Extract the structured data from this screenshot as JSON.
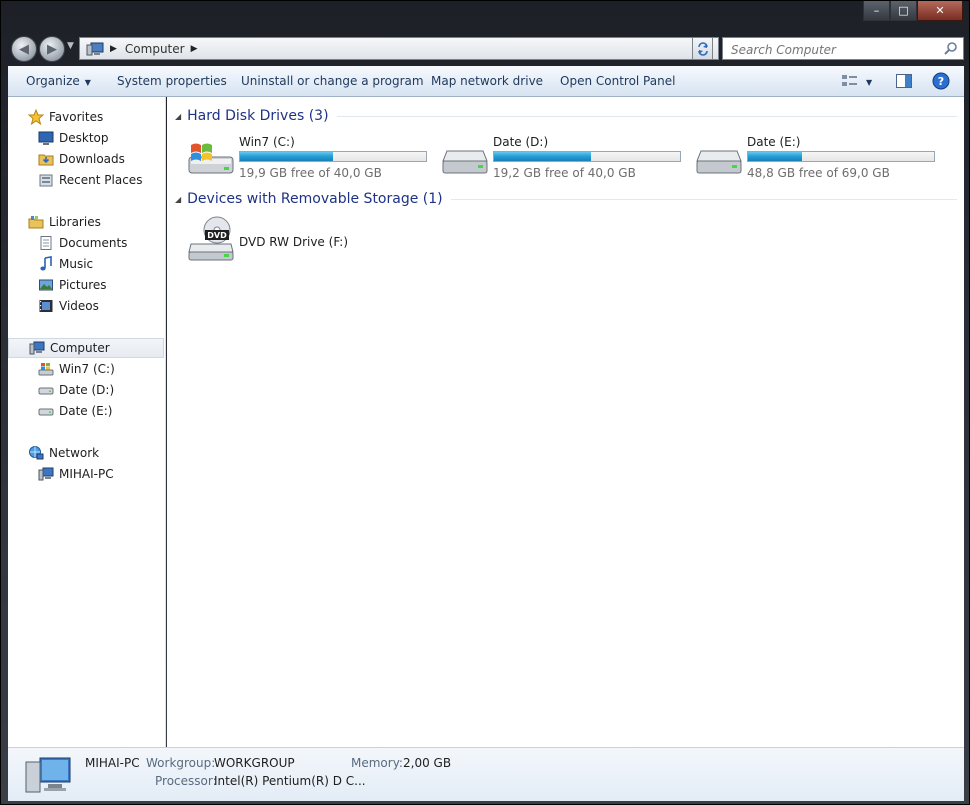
{
  "window": {
    "caption": {
      "minimize": "–",
      "maximize": "□",
      "close": "✕"
    }
  },
  "nav": {
    "back_glyph": "◀",
    "forward_glyph": "▶",
    "address_crumb": "Computer",
    "search_placeholder": "Search Computer"
  },
  "toolbar": {
    "organize": "Organize",
    "system_properties": "System properties",
    "uninstall": "Uninstall or change a program",
    "map_drive": "Map network drive",
    "control_panel": "Open Control Panel"
  },
  "sidebar": {
    "favorites": "Favorites",
    "desktop": "Desktop",
    "downloads": "Downloads",
    "recent": "Recent Places",
    "libraries": "Libraries",
    "documents": "Documents",
    "music": "Music",
    "pictures": "Pictures",
    "videos": "Videos",
    "computer": "Computer",
    "win7": "Win7 (C:)",
    "date_d": "Date (D:)",
    "date_e": "Date (E:)",
    "network": "Network",
    "mihai": "MIHAI-PC"
  },
  "groups": {
    "hdd_title": "Hard Disk Drives (3)",
    "removable_title": "Devices with Removable Storage (1)"
  },
  "drives": [
    {
      "name": "Win7 (C:)",
      "free": "19,9 GB free of 40,0 GB",
      "used_fraction": 0.5025
    },
    {
      "name": "Date (D:)",
      "free": "19,2 GB free of 40,0 GB",
      "used_fraction": 0.52
    },
    {
      "name": "Date (E:)",
      "free": "48,8 GB free of 69,0 GB",
      "used_fraction": 0.2928
    }
  ],
  "removable": {
    "name": "DVD RW Drive (F:)",
    "badge": "DVD"
  },
  "details": {
    "computer_name": "MIHAI-PC",
    "workgroup_label": "Workgroup:",
    "workgroup_value": "WORKGROUP",
    "memory_label": "Memory:",
    "memory_value": "2,00 GB",
    "processor_label": "Processor:",
    "processor_value": "Intel(R) Pentium(R) D  C..."
  },
  "colors": {
    "accent_title": "#1e3287",
    "bar_fill": "#26a0da",
    "toolbar_text": "#1e395b"
  }
}
